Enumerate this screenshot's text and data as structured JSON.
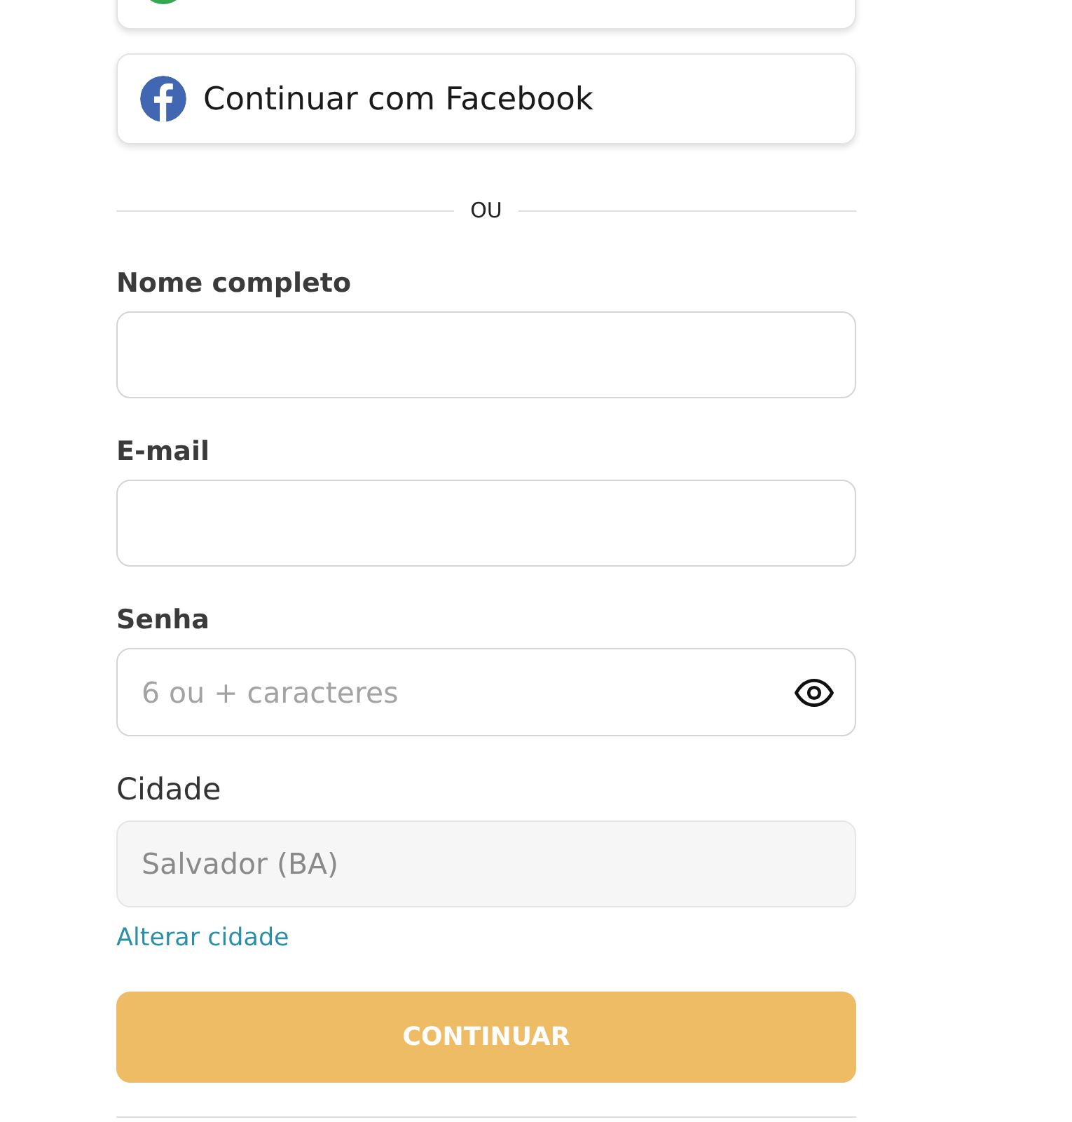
{
  "social_buttons": [
    {
      "kind": "clipped"
    },
    {
      "kind": "facebook",
      "label": "Continuar com Facebook"
    }
  ],
  "divider": {
    "label": "OU"
  },
  "fields": [
    {
      "kind": "text",
      "label": "Nome completo",
      "disabled": false
    },
    {
      "kind": "text",
      "label": "E-mail",
      "disabled": false
    },
    {
      "kind": "password",
      "label": "Senha",
      "placeholder": "6 ou + caracteres",
      "disabled": false
    },
    {
      "kind": "location",
      "label": "Cidade",
      "value": "Salvador (BA)",
      "disabled": true
    }
  ],
  "change_city_link": "Alterar cidade",
  "submit_button": "CONTINUAR"
}
